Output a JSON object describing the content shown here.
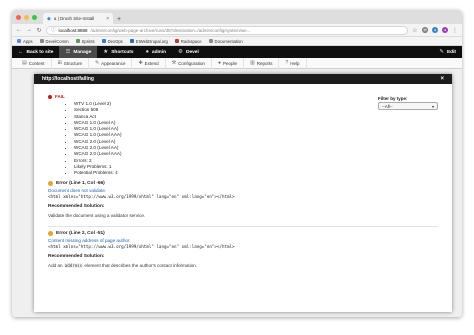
{
  "browser": {
    "tab_title": "a | Drush Site-Install",
    "url_host": "localhost:8888",
    "url_path": "/admin/config/web-page-archive/runs/38?destination=/admin/config/system/we...",
    "bookmarks": [
      {
        "label": "Apps",
        "color": "#5b8de0"
      },
      {
        "label": "DevelComm",
        "color": "#888888"
      },
      {
        "label": "Sprints",
        "color": "#5a9a5a"
      },
      {
        "label": "DevOps",
        "color": "#3a7ac2"
      },
      {
        "label": "EIWebDrupal.org",
        "color": "#2b6cb0"
      },
      {
        "label": "Rackspace",
        "color": "#c0392b"
      },
      {
        "label": "Documentation",
        "color": "#8a8a8a"
      }
    ]
  },
  "toolbar": {
    "back": "Back to site",
    "manage": "Manage",
    "shortcuts": "Shortcuts",
    "user": "admin",
    "devel": "Devel",
    "edit": "Edit"
  },
  "tray": [
    "Content",
    "Structure",
    "Appearance",
    "Extend",
    "Configuration",
    "People",
    "Reports",
    "Help"
  ],
  "modal": {
    "title": "http://localhost/failing",
    "close": "×",
    "filter_label": "Filter by type:",
    "filter_value": "--All--",
    "status": "FAIL",
    "standards": [
      "WTV 1.0 (Level 2)",
      "Section 508",
      "Stanca Act",
      "WCAG 1.0 (Level A)",
      "WCAG 1.0 (Level AA)",
      "WCAG 1.0 (Level AAA)",
      "WCAG 2.0 (Level A)",
      "WCAG 2.0 (Level AA)",
      "WCAG 2.0 (Level AAA)",
      "Errors: 2",
      "Likely Problems: 1",
      "Potential Problems: 4"
    ],
    "issues": [
      {
        "heading": "Error (Line 1, Col -66)",
        "link": "Document does not validate.",
        "code": "<html xmlns=\"http://www.w3.org/1999/xhtml\" lang=\"en\" xml:lang=\"en\"></html>",
        "solution_label": "Recommended Solution:",
        "solution_before": "Validate the document using a validator service.",
        "solution_code": "",
        "solution_after": ""
      },
      {
        "heading": "Error (Line 2, Col -51)",
        "link": "Content missing address of page author.",
        "code": "<html xmlns=\"http://www.w3.org/1999/xhtml\" lang=\"en\" xml:lang=\"en\"></html>",
        "solution_label": "Recommended Solution:",
        "solution_before": "Add an ",
        "solution_code": "address",
        "solution_after": " element that describes the author's contact information."
      }
    ]
  }
}
